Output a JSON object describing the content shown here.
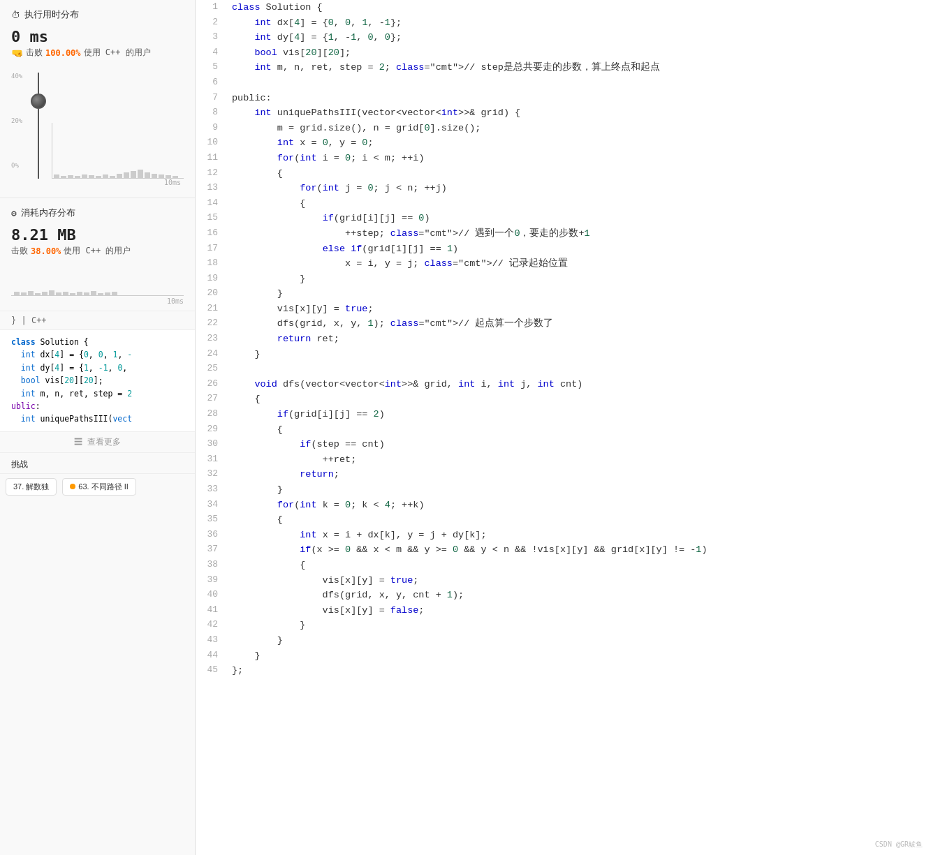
{
  "left": {
    "time_section_title": "执行用时分布",
    "time_value": "0 ms",
    "time_desc_prefix": "击败",
    "time_percent": "100.00%",
    "time_desc_suffix": "使用 C++ 的用户",
    "mem_section_title": "消耗内存分布",
    "mem_value": "8.21 MB",
    "mem_desc_prefix": "击败",
    "mem_percent": "38.00%",
    "mem_desc_suffix": "使用 C++ 的用户",
    "chart_x_label": "10ms",
    "mini_chart_x_label": "10ms",
    "lang_label": "C++",
    "code_lines": [
      "class Solution {",
      "    int dx[4] = {0, 0, 1, -",
      "    int dy[4] = {1, -1, 0,",
      "    bool vis[20][20];",
      "    int m, n, ret, step = 2"
    ],
    "public_label": "ublic:",
    "method_label": "    int uniquePathsIII(vect",
    "view_more": "☰ 查看更多",
    "challenge_label": "挑战",
    "btn1_label": "37. 解数独",
    "btn2_label": "63. 不同路径 II"
  },
  "code": {
    "lines": [
      {
        "n": 1,
        "code": "class Solution {"
      },
      {
        "n": 2,
        "code": "    int dx[4] = {0, 0, 1, -1};"
      },
      {
        "n": 3,
        "code": "    int dy[4] = {1, -1, 0, 0};"
      },
      {
        "n": 4,
        "code": "    bool vis[20][20];"
      },
      {
        "n": 5,
        "code": "    int m, n, ret, step = 2; // step是总共要走的步数，算上终点和起点"
      },
      {
        "n": 6,
        "code": ""
      },
      {
        "n": 7,
        "code": "public:"
      },
      {
        "n": 8,
        "code": "    int uniquePathsIII(vector<vector<int>>& grid) {"
      },
      {
        "n": 9,
        "code": "        m = grid.size(), n = grid[0].size();"
      },
      {
        "n": 10,
        "code": "        int x = 0, y = 0;"
      },
      {
        "n": 11,
        "code": "        for(int i = 0; i < m; ++i)"
      },
      {
        "n": 12,
        "code": "        {"
      },
      {
        "n": 13,
        "code": "            for(int j = 0; j < n; ++j)"
      },
      {
        "n": 14,
        "code": "            {"
      },
      {
        "n": 15,
        "code": "                if(grid[i][j] == 0)"
      },
      {
        "n": 16,
        "code": "                    ++step; // 遇到一个0，要走的步数+1"
      },
      {
        "n": 17,
        "code": "                else if(grid[i][j] == 1)"
      },
      {
        "n": 18,
        "code": "                    x = i, y = j; // 记录起始位置"
      },
      {
        "n": 19,
        "code": "            }"
      },
      {
        "n": 20,
        "code": "        }"
      },
      {
        "n": 21,
        "code": "        vis[x][y] = true;"
      },
      {
        "n": 22,
        "code": "        dfs(grid, x, y, 1); // 起点算一个步数了"
      },
      {
        "n": 23,
        "code": "        return ret;"
      },
      {
        "n": 24,
        "code": "    }"
      },
      {
        "n": 25,
        "code": ""
      },
      {
        "n": 26,
        "code": "    void dfs(vector<vector<int>>& grid, int i, int j, int cnt)"
      },
      {
        "n": 27,
        "code": "    {"
      },
      {
        "n": 28,
        "code": "        if(grid[i][j] == 2)"
      },
      {
        "n": 29,
        "code": "        {"
      },
      {
        "n": 30,
        "code": "            if(step == cnt)"
      },
      {
        "n": 31,
        "code": "                ++ret;"
      },
      {
        "n": 32,
        "code": "            return;"
      },
      {
        "n": 33,
        "code": "        }"
      },
      {
        "n": 34,
        "code": "        for(int k = 0; k < 4; ++k)"
      },
      {
        "n": 35,
        "code": "        {"
      },
      {
        "n": 36,
        "code": "            int x = i + dx[k], y = j + dy[k];"
      },
      {
        "n": 37,
        "code": "            if(x >= 0 && x < m && y >= 0 && y < n && !vis[x][y] && grid[x][y] != -1)"
      },
      {
        "n": 38,
        "code": "            {"
      },
      {
        "n": 39,
        "code": "                vis[x][y] = true;"
      },
      {
        "n": 40,
        "code": "                dfs(grid, x, y, cnt + 1);"
      },
      {
        "n": 41,
        "code": "                vis[x][y] = false;"
      },
      {
        "n": 42,
        "code": "            }"
      },
      {
        "n": 43,
        "code": "        }"
      },
      {
        "n": 44,
        "code": "    }"
      },
      {
        "n": 45,
        "code": "};"
      }
    ]
  },
  "watermark": "CSDN @GR鲅鱼"
}
